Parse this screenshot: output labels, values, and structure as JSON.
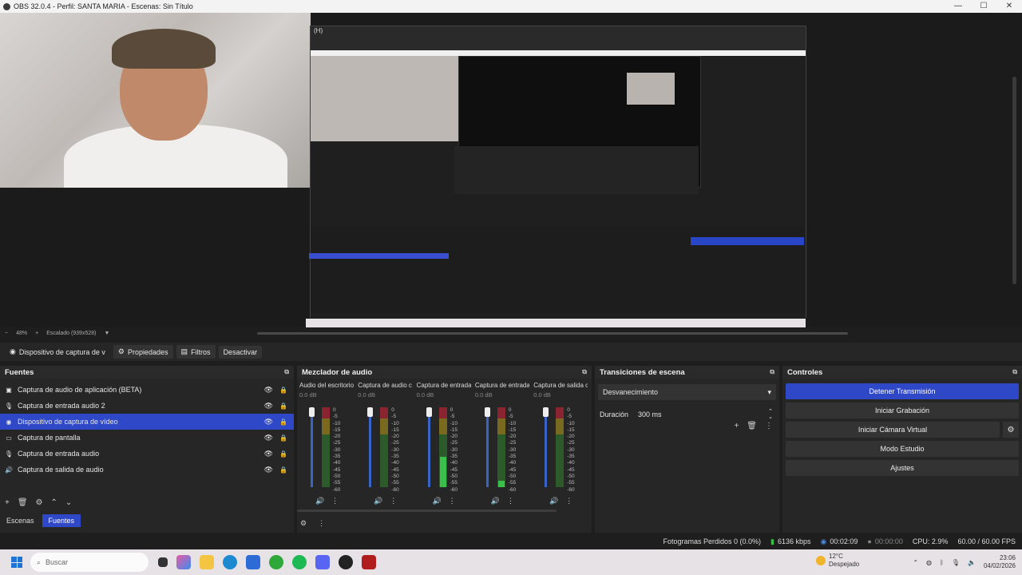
{
  "window": {
    "title": "OBS 32.0.4 - Perfil: SANTA MARIA - Escenas: Sin Título",
    "min": "—",
    "max": "☐",
    "close": "✕"
  },
  "preview": {
    "hotkey_label": "(H)",
    "zoom": "48%",
    "scaling": "Escalado (939x528)"
  },
  "source_bar": {
    "selected": "Dispositivo de captura de v",
    "properties": "Propiedades",
    "filters": "Filtros",
    "deactivate": "Desactivar"
  },
  "sources": {
    "title": "Fuentes",
    "items": [
      {
        "label": "Captura de audio de aplicación (BETA)",
        "icon": "app-audio-icon",
        "glyph": "▣"
      },
      {
        "label": "Captura de entrada audio 2",
        "icon": "mic-icon",
        "glyph": "🎙"
      },
      {
        "label": "Dispositivo de captura de vídeo",
        "icon": "camera-icon",
        "glyph": "◉",
        "selected": true
      },
      {
        "label": "Captura de pantalla",
        "icon": "monitor-icon",
        "glyph": "▭"
      },
      {
        "label": "Captura de entrada audio",
        "icon": "mic-icon",
        "glyph": "🎙"
      },
      {
        "label": "Captura de salida de audio",
        "icon": "speaker-icon",
        "glyph": "🔊"
      }
    ],
    "tab_scenes": "Escenas",
    "tab_sources": "Fuentes"
  },
  "mixer": {
    "title": "Mezclador de audio",
    "scale": [
      "0",
      "-5",
      "-10",
      "-15",
      "-20",
      "-25",
      "-30",
      "-35",
      "-40",
      "-45",
      "-50",
      "-55",
      "-60"
    ],
    "channels": [
      {
        "name": "Audio del escritorio",
        "db": "0.0 dB",
        "level": 0.0
      },
      {
        "name": "Captura de audio c",
        "db": "0.0 dB",
        "level": 0.0
      },
      {
        "name": "Captura de entrada",
        "db": "0.0 dB",
        "level": 0.38
      },
      {
        "name": "Captura de entrada",
        "db": "0.0 dB",
        "level": 0.08
      },
      {
        "name": "Captura de salida c",
        "db": "0.0 dB",
        "level": 0.0
      }
    ]
  },
  "transitions": {
    "title": "Transiciones de escena",
    "selected": "Desvanecimiento",
    "duration_label": "Duración",
    "duration_value": "300 ms"
  },
  "controls": {
    "title": "Controles",
    "stop_stream": "Detener Transmisión",
    "start_record": "Iniciar Grabación",
    "start_vcam": "Iniciar Cámara Virtual",
    "studio_mode": "Modo Estudio",
    "settings": "Ajustes"
  },
  "status": {
    "dropped": "Fotogramas Perdidos 0 (0.0%)",
    "bitrate": "6136 kbps",
    "stream_time": "00:02:09",
    "rec_time": "00:00:00",
    "cpu": "CPU: 2.9%",
    "fps": "60.00 / 60.00 FPS"
  },
  "taskbar": {
    "search_placeholder": "Buscar",
    "weather_temp": "12°C",
    "weather_desc": "Despejado",
    "time": "23:06",
    "date": "04/02/2026"
  },
  "colors": {
    "accent": "#2f48c8",
    "panel": "#262626",
    "meter_green": "#39c04b"
  }
}
